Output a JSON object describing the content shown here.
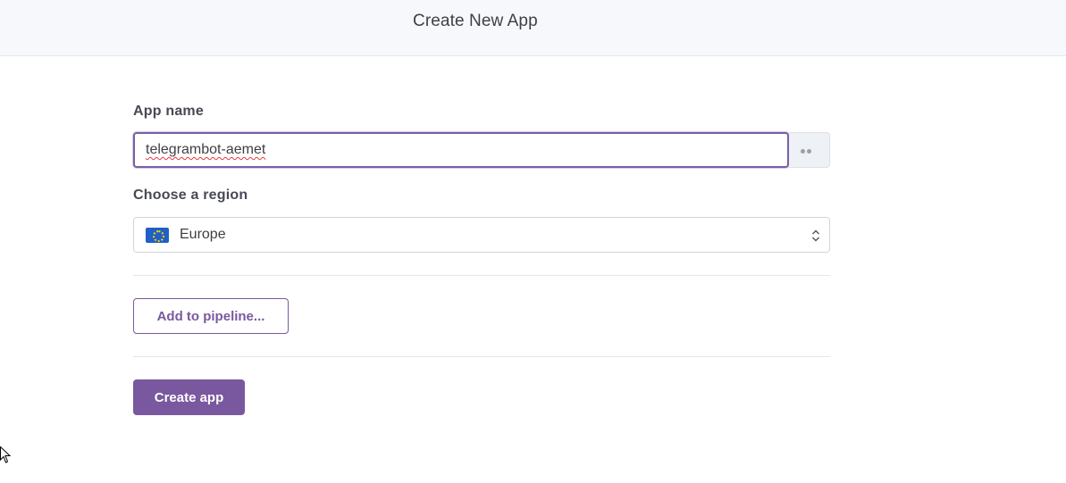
{
  "header": {
    "title": "Create New App"
  },
  "form": {
    "app_name_label": "App name",
    "app_name_value": "telegrambot-aemet",
    "region_label": "Choose a region",
    "region_value": "Europe",
    "region_flag_icon": "eu-flag-icon",
    "pipeline_button": "Add to pipeline...",
    "create_button": "Create app"
  },
  "colors": {
    "accent": "#79589f",
    "header_bg": "#f7f8fb"
  }
}
